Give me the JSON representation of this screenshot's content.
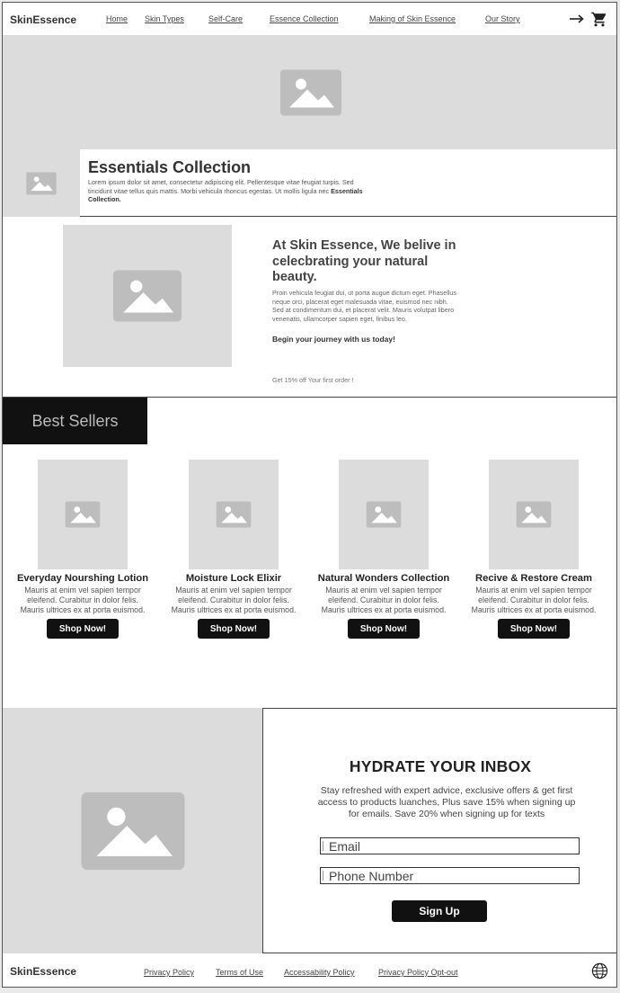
{
  "header": {
    "brand": "SkinEssence",
    "nav": [
      "Home",
      "Skin Types",
      "Self-Care",
      "Essence Collection",
      "Making of Skin Essence",
      "Our Story"
    ],
    "icons": [
      "arrow-right-icon",
      "cart-icon"
    ]
  },
  "essentials": {
    "title": "Essentials Collection",
    "body": "Lorem ipsum dolor sit amet, consectetur adipiscing elit. Pellentesque vitae feugiat turpis. Sed tincidunt vitae tellus quis mattis. Morbi vehicula rhoncus egestas. Ut mollis ligula nec",
    "body_bold": "Essentials Collection."
  },
  "about": {
    "title": "At Skin Essence, We belive in celecbrating your natural beauty.",
    "body": "Proin vehicula feugiat dui, ut porta augue dictum eget. Phasellus neque orci, placerat eget malesuada vitae, euismod nec nibh. Sed at condimentum dui, et placerat velit. Mauris volutpat libero venenatis, ullamcorper sapien eget, finibus leo.",
    "cta": "Begin your journey with us today!",
    "promo": "Get 15% off Your first order !"
  },
  "best_sellers": {
    "title": "Best Sellers",
    "products": [
      {
        "name": "Everyday Nourshing Lotion",
        "desc": "Mauris at enim vel sapien tempor eleifend. Curabitur in dolor felis. Mauris ultrices ex at porta euismod.",
        "button": "Shop Now!"
      },
      {
        "name": "Moisture Lock Elixir",
        "desc": "Mauris at enim vel sapien tempor eleifend. Curabitur in dolor felis. Mauris ultrices ex at porta euismod.",
        "button": "Shop Now!"
      },
      {
        "name": "Natural Wonders Collection",
        "desc": "Mauris at enim vel sapien tempor eleifend. Curabitur in dolor felis. Mauris ultrices ex at porta euismod.",
        "button": "Shop Now!"
      },
      {
        "name": "Recive & Restore Cream",
        "desc": "Mauris at enim vel sapien tempor eleifend. Curabitur in dolor felis. Mauris ultrices ex at porta euismod.",
        "button": "Shop Now!"
      }
    ]
  },
  "inbox": {
    "title": "HYDRATE YOUR INBOX",
    "text": "Stay refreshed with expert advice, exclusive offers & get first access to products luanches, Plus save 15% when signing up for emails. Save 20% when signing up for texts",
    "email_placeholder": "Email",
    "phone_placeholder": "Phone Number",
    "button": "Sign Up"
  },
  "footer": {
    "brand": "SkinEssence",
    "links": [
      "Privacy Policy",
      "Terms of Use",
      "Accessability Policy",
      "Privacy Policy Opt-out"
    ],
    "icon": "globe-icon"
  },
  "colors": {
    "placeholder_bg": "#dcdcdc",
    "placeholder_icon": "#bdbdbd",
    "dark": "#111111"
  }
}
